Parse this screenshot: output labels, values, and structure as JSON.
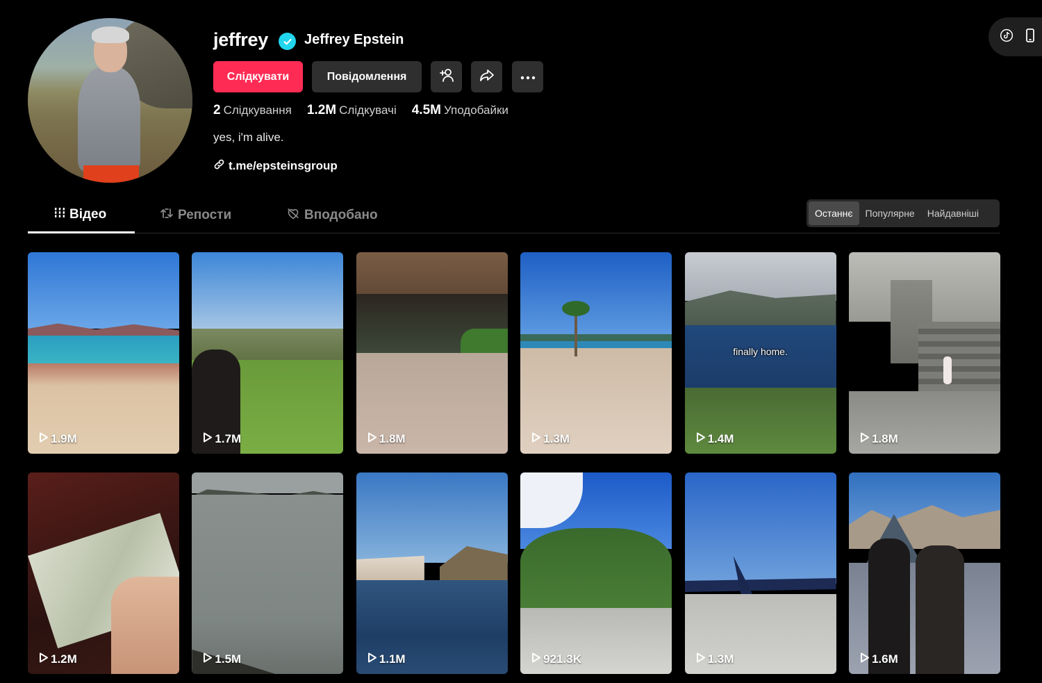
{
  "profile": {
    "username": "jeffrey",
    "display_name": "Jeffrey Epstein",
    "follow_label": "Слідкувати",
    "message_label": "Повідомлення",
    "stats": [
      {
        "num": "2",
        "label": "Слідкування"
      },
      {
        "num": "1.2M",
        "label": "Слідкувачі"
      },
      {
        "num": "4.5M",
        "label": "Уподобайки"
      }
    ],
    "bio": "yes, i'm alive.",
    "link": "t.me/epsteinsgroup"
  },
  "tabs": [
    {
      "label": "Відео"
    },
    {
      "label": "Репости"
    },
    {
      "label": "Вподобано"
    }
  ],
  "sort": [
    {
      "label": "Останнє"
    },
    {
      "label": "Популярне"
    },
    {
      "label": "Найдавніші"
    }
  ],
  "videos": [
    {
      "views": "1.9M"
    },
    {
      "views": "1.7M"
    },
    {
      "views": "1.8M"
    },
    {
      "views": "1.3M"
    },
    {
      "views": "1.4M",
      "caption": "finally home."
    },
    {
      "views": "1.8M"
    },
    {
      "views": "1.2M"
    },
    {
      "views": "1.5M"
    },
    {
      "views": "1.1M"
    },
    {
      "views": "921.3K"
    },
    {
      "views": "1.3M"
    },
    {
      "views": "1.6M"
    }
  ],
  "colors": {
    "accent": "#fe2c55",
    "verified": "#20d5ec",
    "background": "#000000"
  }
}
